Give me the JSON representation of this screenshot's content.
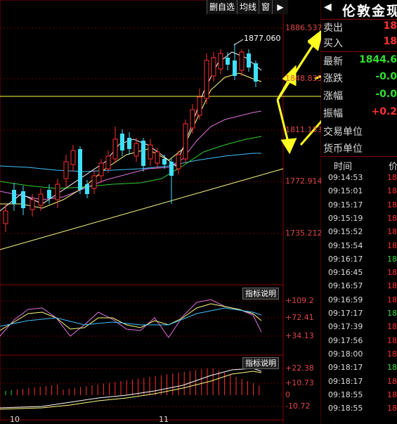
{
  "toolbar": {
    "btn1": "删自选",
    "btn2": "均线",
    "btn3": "窗",
    "arrow": "▶"
  },
  "price_axis": [
    "1886.537",
    "1848.835",
    "1811.133",
    "1772.914",
    "1735.212"
  ],
  "high_marker": "1877.060",
  "indicator1": {
    "button": "指标说明",
    "labels": [
      "+109.2",
      "+72.41",
      "+34.13"
    ]
  },
  "indicator2": {
    "button": "指标说明",
    "labels": [
      "+22.38",
      "+10.73",
      "0",
      "-10.72"
    ]
  },
  "date_ticks": [
    "10",
    "11"
  ],
  "panel": {
    "title": "伦敦金现",
    "left_arrow": "◀",
    "sell_label": "卖出",
    "sell_value": "18",
    "buy_label": "买入",
    "buy_value": "18",
    "latest_label": "最新",
    "latest_value": "1844.6",
    "change_label": "涨跌",
    "change_value": "-0.0",
    "pct_label": "涨幅",
    "pct_value": "-0.0",
    "amp_label": "振幅",
    "amp_value": "+0.2",
    "trade_unit_label": "交易单位",
    "currency_unit_label": "货币单位",
    "ticks_header": {
      "time": "时间",
      "price": "价"
    },
    "ticks": [
      {
        "time": "09:14:53",
        "price": "18",
        "color": "red"
      },
      {
        "time": "09:15:01",
        "price": "18",
        "color": "red"
      },
      {
        "time": "09:15:17",
        "price": "18",
        "color": "red"
      },
      {
        "time": "09:15:19",
        "price": "18",
        "color": "red"
      },
      {
        "time": "09:15:52",
        "price": "18",
        "color": "red"
      },
      {
        "time": "09:15:54",
        "price": "18",
        "color": "red"
      },
      {
        "time": "09:16:17",
        "price": "18",
        "color": "green"
      },
      {
        "time": "09:16:45",
        "price": "18",
        "color": "red"
      },
      {
        "time": "09:16:57",
        "price": "18",
        "color": "red"
      },
      {
        "time": "09:16:59",
        "price": "18",
        "color": "red"
      },
      {
        "time": "09:17:17",
        "price": "18",
        "color": "green"
      },
      {
        "time": "09:17:39",
        "price": "18",
        "color": "red"
      },
      {
        "time": "09:17:56",
        "price": "18",
        "color": "red"
      },
      {
        "time": "09:18:00",
        "price": "18",
        "color": "red"
      },
      {
        "time": "09:18:17",
        "price": "18",
        "color": "green"
      },
      {
        "time": "09:18:17",
        "price": "18",
        "color": "red"
      },
      {
        "time": "09:18:55",
        "price": "18",
        "color": "red"
      },
      {
        "time": "09:18:55",
        "price": "18",
        "color": "red"
      }
    ]
  },
  "colors": {
    "up": "#ff3030",
    "down": "#40e0ff",
    "grid": "#8b0000",
    "hline": "#ffff40",
    "arrow": "#ffff20"
  }
}
